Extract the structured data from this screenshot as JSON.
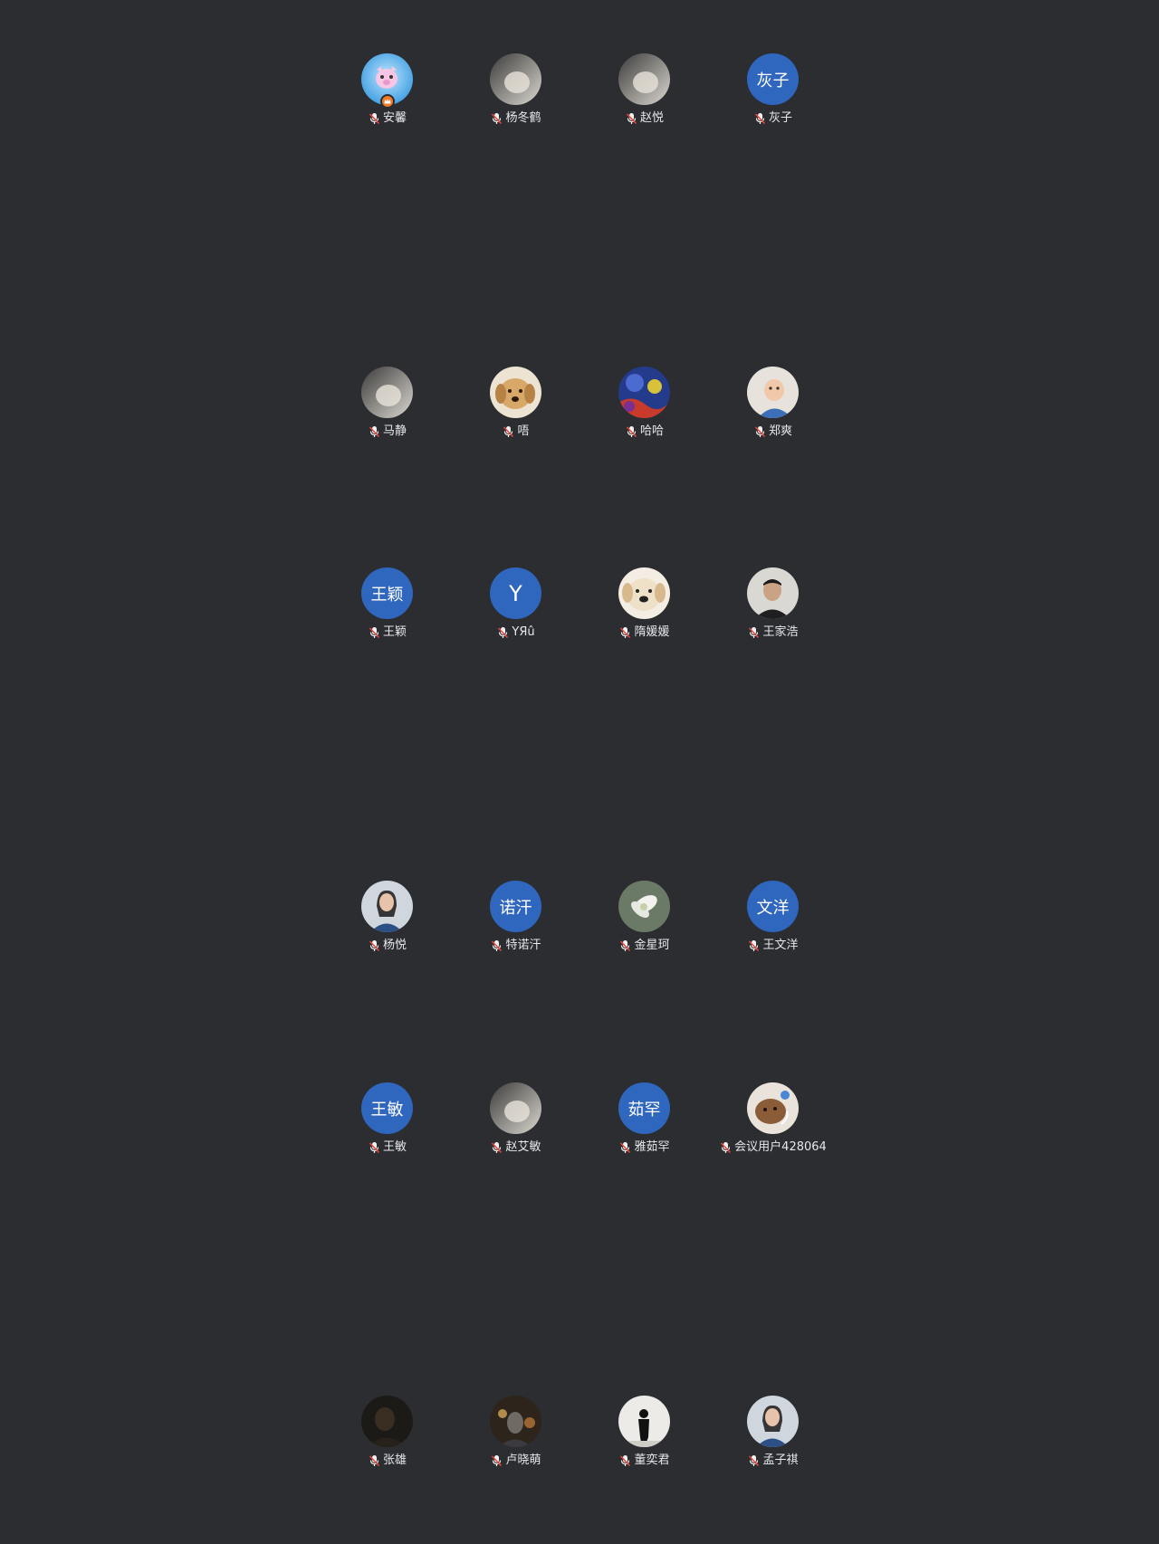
{
  "participants": [
    {
      "name": "安馨",
      "avatar": "cartoon-pig-icon",
      "host": true
    },
    {
      "name": "杨冬鹤",
      "avatar": "photo-avatar"
    },
    {
      "name": "赵悦",
      "avatar": "photo-avatar"
    },
    {
      "name": "灰子",
      "initials": "灰子"
    },
    {
      "name": "马静",
      "avatar": "photo-avatar"
    },
    {
      "name": "唔",
      "avatar": "dog-photo-avatar"
    },
    {
      "name": "哈哈",
      "avatar": "starry-painting-avatar"
    },
    {
      "name": "郑爽",
      "avatar": "baby-photo-avatar"
    },
    {
      "name": "王颖",
      "initials": "王颖"
    },
    {
      "name": "YЯû",
      "initials": "Y"
    },
    {
      "name": "隋媛媛",
      "avatar": "puppy-photo-avatar"
    },
    {
      "name": "王家浩",
      "avatar": "man-photo-avatar"
    },
    {
      "name": "杨悦",
      "avatar": "woman-photo-avatar"
    },
    {
      "name": "特诺汗",
      "initials": "诺汗"
    },
    {
      "name": "金星珂",
      "avatar": "flower-photo-avatar"
    },
    {
      "name": "王文洋",
      "initials": "文洋"
    },
    {
      "name": "王敏",
      "initials": "王敏"
    },
    {
      "name": "赵艾敏",
      "avatar": "photo-avatar"
    },
    {
      "name": "雅茹罕",
      "initials": "茹罕"
    },
    {
      "name": "会议用户428064",
      "avatar": "pet-photo-avatar"
    },
    {
      "name": "张雄",
      "avatar": "dark-photo-avatar"
    },
    {
      "name": "卢晓萌",
      "avatar": "night-photo-avatar"
    },
    {
      "name": "董奕君",
      "avatar": "silhouette-photo-avatar"
    },
    {
      "name": "孟子祺",
      "avatar": "woman-photo-avatar"
    }
  ],
  "colors": {
    "background": "#2b2d31",
    "initials_avatar": "#2f66be",
    "host_badge": "#f07a28",
    "mic_muted": "#e8463c",
    "name_text": "#e6e7ea"
  }
}
